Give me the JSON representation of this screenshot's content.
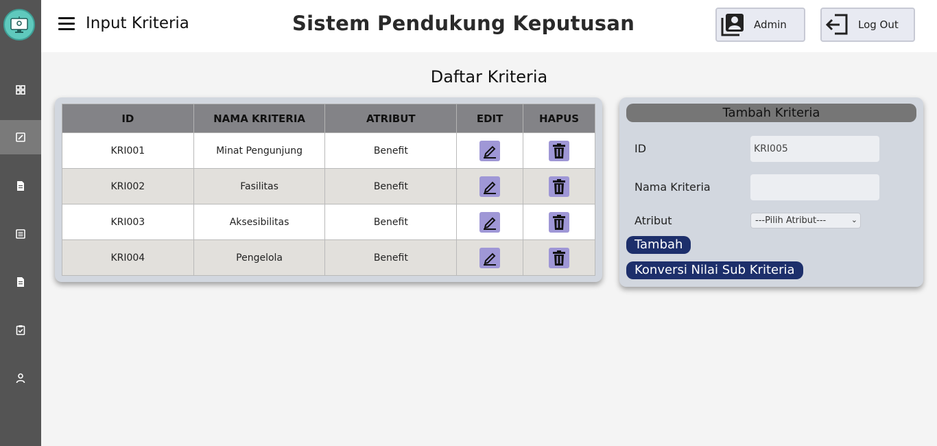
{
  "header": {
    "page_title": "Input Kriteria",
    "app_title": "Sistem Pendukung Keputusan",
    "admin_label": "Admin",
    "logout_label": "Log Out"
  },
  "main": {
    "list_title": "Daftar Kriteria"
  },
  "table": {
    "headers": [
      "ID",
      "NAMA KRITERIA",
      "ATRIBUT",
      "EDIT",
      "HAPUS"
    ],
    "rows": [
      {
        "id": "KRI001",
        "nama": "Minat Pengunjung",
        "atribut": "Benefit"
      },
      {
        "id": "KRI002",
        "nama": "Fasilitas",
        "atribut": "Benefit"
      },
      {
        "id": "KRI003",
        "nama": "Aksesibilitas",
        "atribut": "Benefit"
      },
      {
        "id": "KRI004",
        "nama": "Pengelola",
        "atribut": "Benefit"
      }
    ]
  },
  "form": {
    "title": "Tambah Kriteria",
    "id_label": "ID",
    "id_value": "KRI005",
    "nama_label": "Nama Kriteria",
    "nama_value": "",
    "atribut_label": "Atribut",
    "atribut_selected": "---Pilih Atribut---",
    "tambah_label": "Tambah",
    "konversi_label": "Konversi Nilai Sub Kriteria"
  },
  "colors": {
    "sidebar": "#545454",
    "action_button": "#9f97d6",
    "primary_button": "#1d2f6b"
  }
}
